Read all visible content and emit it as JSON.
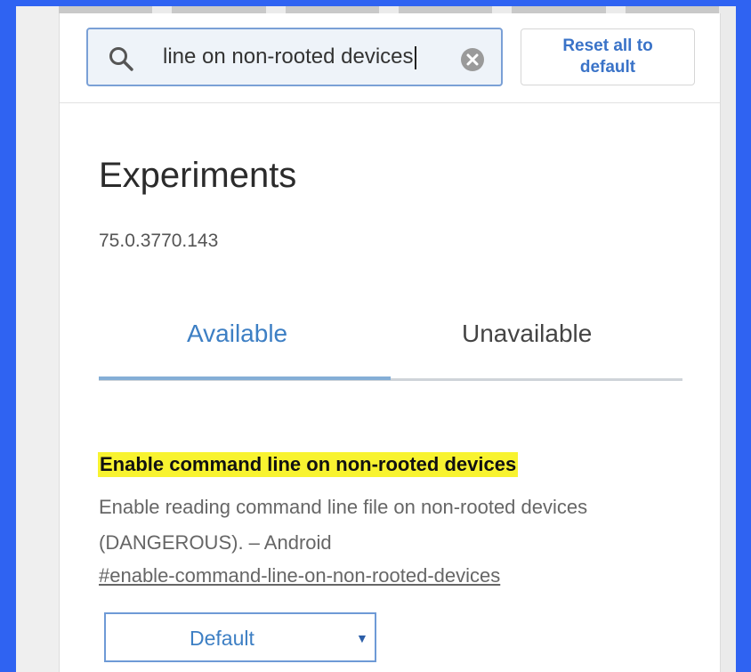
{
  "search": {
    "value": "line on non-rooted devices"
  },
  "toolbar": {
    "reset_label": "Reset all to default"
  },
  "page": {
    "title": "Experiments",
    "version": "75.0.3770.143"
  },
  "tabs": [
    {
      "label": "Available",
      "selected": true
    },
    {
      "label": "Unavailable",
      "selected": false
    }
  ],
  "flag": {
    "title": "Enable command line on non-rooted devices",
    "description": "Enable reading command line file on non-rooted devices (DANGEROUS). – Android",
    "anchor": "#enable-command-line-on-non-rooted-devices",
    "select_value": "Default"
  },
  "colors": {
    "accent": "#3d7fc4",
    "highlight": "#f8f330",
    "background": "#2f63f2"
  },
  "icons": {
    "search": "search-icon",
    "clear": "clear-icon",
    "dropdown": "dropdown-arrow-icon"
  }
}
